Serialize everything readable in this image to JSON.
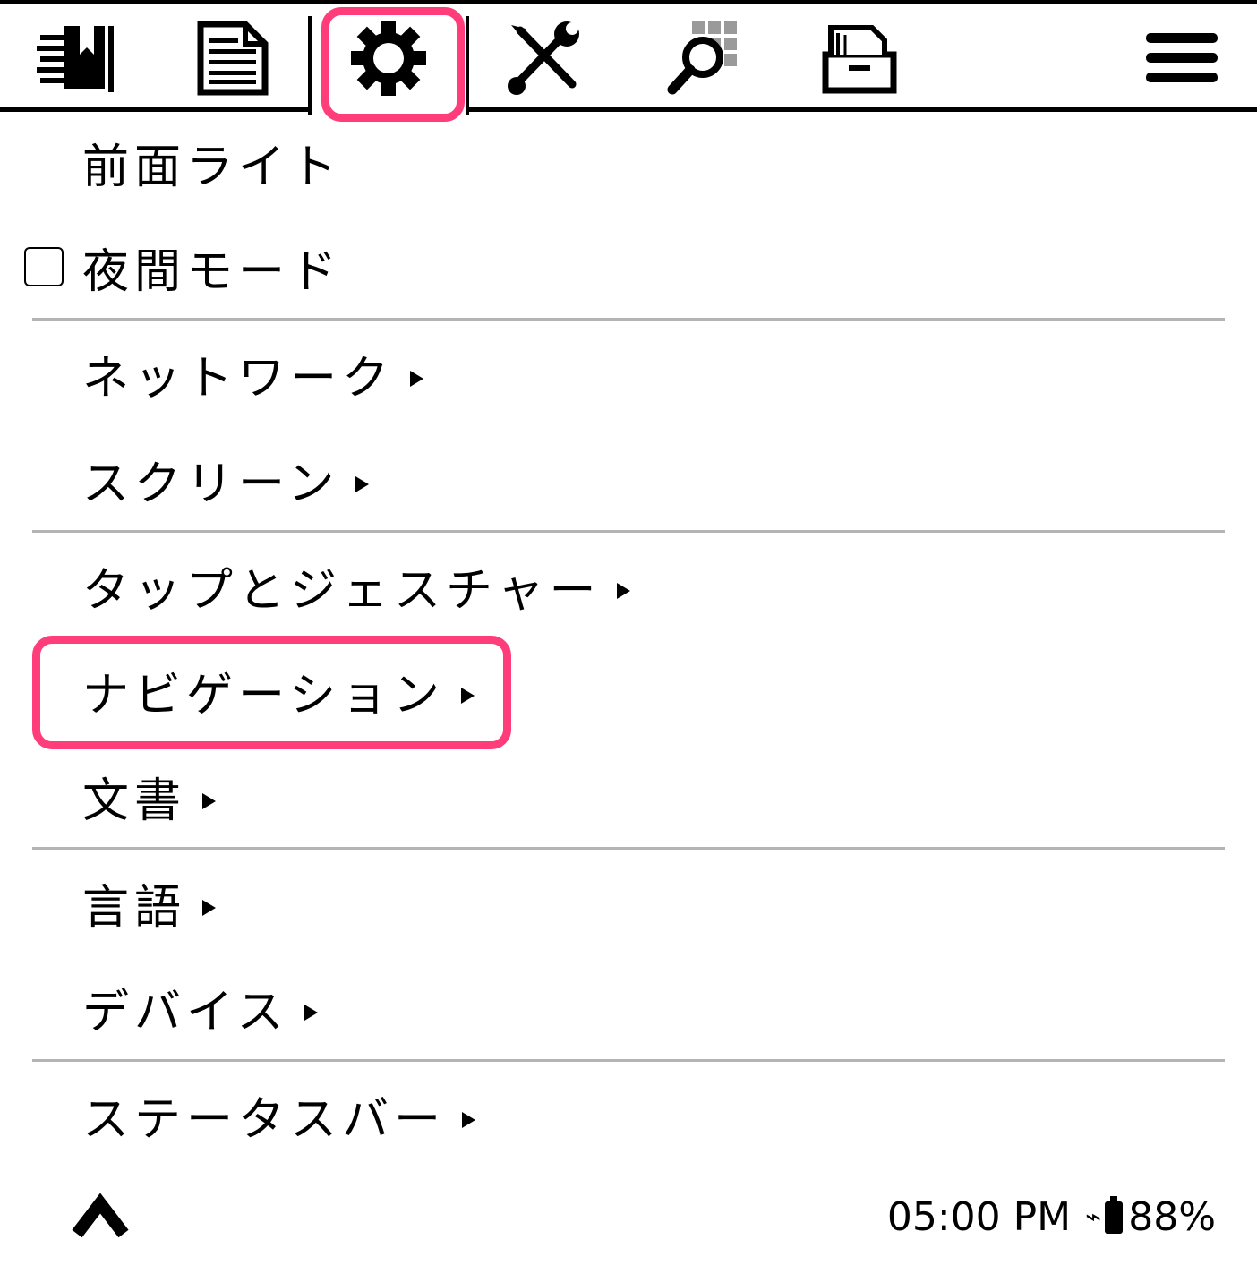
{
  "tabs": [
    {
      "name": "bookmark-list-icon",
      "selected": false
    },
    {
      "name": "document-icon",
      "selected": false
    },
    {
      "name": "gear-icon",
      "selected": true
    },
    {
      "name": "tools-icon",
      "selected": false
    },
    {
      "name": "search-grid-icon",
      "selected": false
    },
    {
      "name": "file-cabinet-icon",
      "selected": false
    }
  ],
  "menu_icon": "hamburger-menu-icon",
  "menu": {
    "frontlight": "前面ライト",
    "night_mode": "夜間モード",
    "night_mode_checked": false,
    "network": "ネットワーク",
    "screen": "スクリーン",
    "taps_gestures": "タップとジェスチャー",
    "navigation": "ナビゲーション",
    "document": "文書",
    "language": "言語",
    "device": "デバイス",
    "status_bar": "ステータスバー"
  },
  "status": {
    "time": "05:00 PM",
    "charging_symbol": "⌁",
    "battery": "88%"
  },
  "colors": {
    "highlight": "#ff3d7a",
    "divider": "#b4b4b4"
  }
}
